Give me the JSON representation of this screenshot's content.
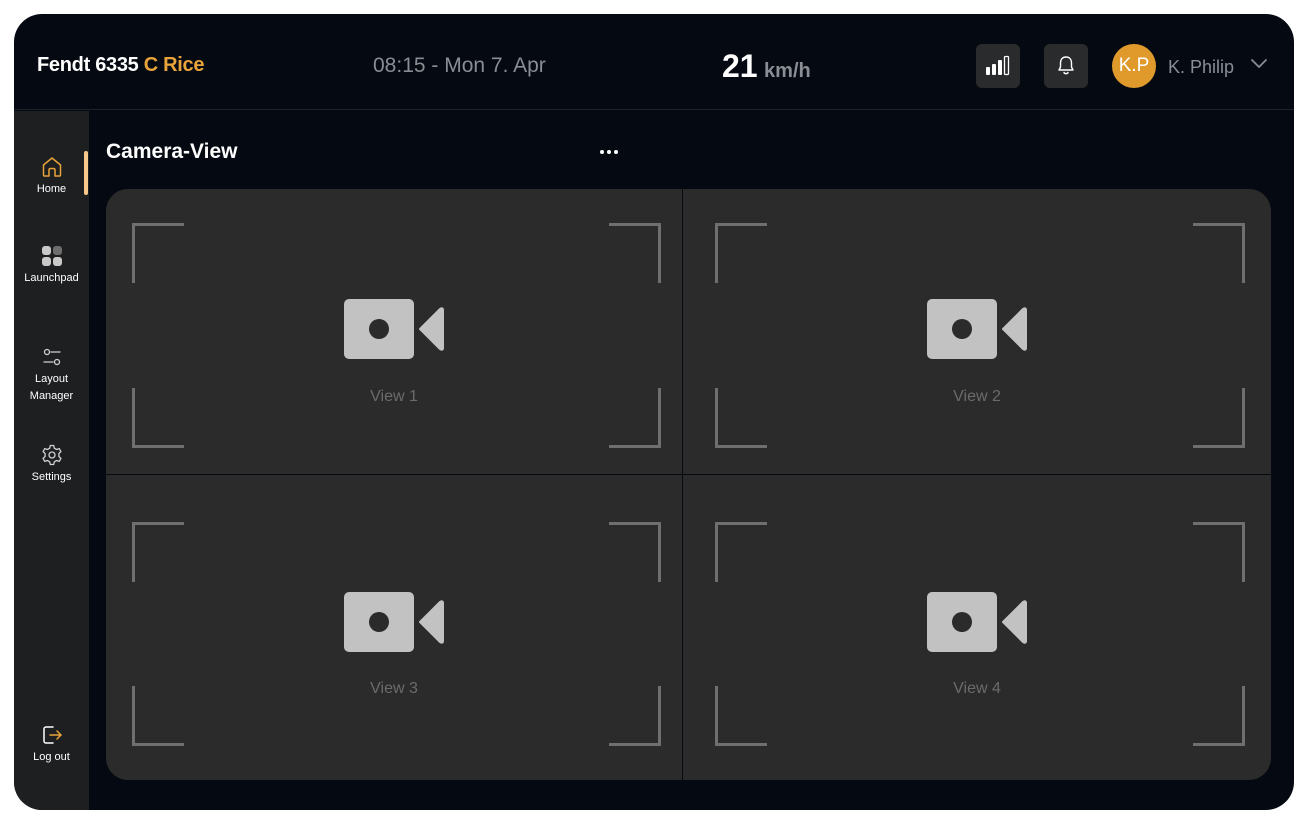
{
  "header": {
    "vehicle_name": "Fendt 6335",
    "vehicle_variant": "C Rice",
    "datetime": "08:15 - Mon 7. Apr",
    "speed_value": "21",
    "speed_unit": "km/h",
    "signal_icon": "signal-bars-icon",
    "notification_icon": "bell-icon",
    "avatar_initials": "K.P",
    "user_name": "K. Philip",
    "user_menu_icon": "chevron-down-icon"
  },
  "sidebar": {
    "items": [
      {
        "label": "Home",
        "icon": "home-icon",
        "active": true
      },
      {
        "label": "Launchpad",
        "icon": "grid-icon",
        "active": false
      },
      {
        "label": "Layout Manager",
        "icon": "sliders-icon",
        "active": false
      },
      {
        "label": "Settings",
        "icon": "gear-icon",
        "active": false
      }
    ],
    "logout": {
      "label": "Log out",
      "icon": "logout-icon"
    }
  },
  "main": {
    "title": "Camera-View",
    "more_icon": "more-horizontal-icon",
    "views": [
      {
        "label": "View 1",
        "icon": "video-camera-icon"
      },
      {
        "label": "View 2",
        "icon": "video-camera-icon"
      },
      {
        "label": "View 3",
        "icon": "video-camera-icon"
      },
      {
        "label": "View 4",
        "icon": "video-camera-icon"
      }
    ]
  },
  "colors": {
    "background": "#050a12",
    "sidebar": "#1e1f21",
    "panel": "#2b2b2b",
    "accent": "#e8a33a",
    "active_indicator": "#f7c889",
    "avatar": "#e09a2c"
  }
}
